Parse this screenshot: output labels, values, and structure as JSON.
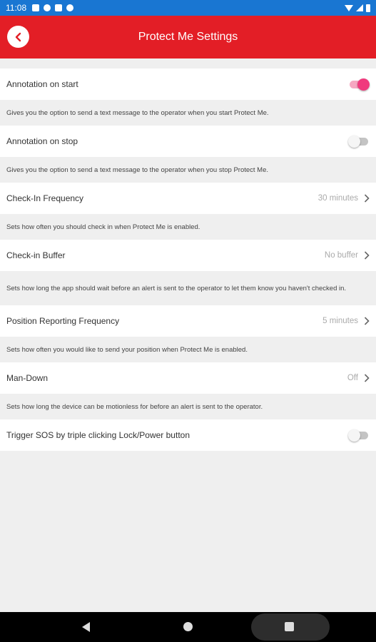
{
  "status_bar": {
    "time": "11:08"
  },
  "app_bar": {
    "title": "Protect Me Settings"
  },
  "settings": [
    {
      "label": "Annotation on start",
      "control": "toggle",
      "checked": true,
      "description": "Gives you the option to send a text message to the operator when you start Protect Me."
    },
    {
      "label": "Annotation on stop",
      "control": "toggle",
      "checked": false,
      "description": "Gives you the option to send a text message to the operator when you stop Protect Me."
    },
    {
      "label": "Check-In Frequency",
      "control": "chevron",
      "value": "30 minutes",
      "description": "Sets how often you should check in when Protect Me is enabled."
    },
    {
      "label": "Check-in Buffer",
      "control": "chevron",
      "value": "No buffer",
      "description": "Sets how long the app should wait before an alert is sent to the operator to let them know you haven't checked in."
    },
    {
      "label": "Position Reporting Frequency",
      "control": "chevron",
      "value": "5 minutes",
      "description": "Sets how often you would like to send your position when Protect Me is enabled."
    },
    {
      "label": "Man-Down",
      "control": "chevron",
      "value": "Off",
      "description": "Sets how long the device can be motionless for before an alert is sent to the operator."
    },
    {
      "label": "Trigger SOS by triple clicking Lock/Power button",
      "control": "toggle",
      "checked": false
    }
  ],
  "colors": {
    "app_bar": "#e31e26",
    "status_bar": "#1976d2",
    "toggle_on": "#f03a7d",
    "background": "#efefef"
  },
  "icons": {
    "back": "arrow-left-icon",
    "chevron": "chevron-right-icon"
  }
}
